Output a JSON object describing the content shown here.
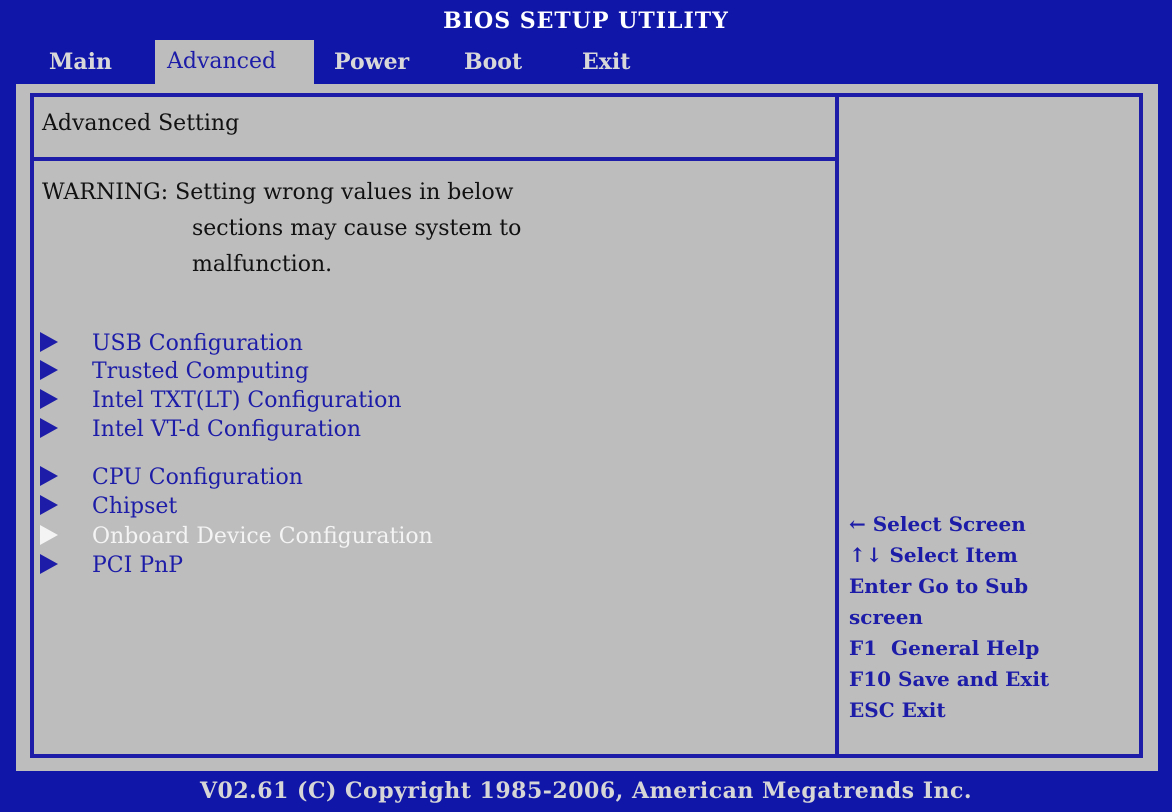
{
  "window": {
    "title": "BIOS SETUP UTILITY"
  },
  "menu": {
    "tabs": [
      "Main",
      "Advanced",
      "Power",
      "Boot",
      "Exit"
    ],
    "active_tab": "Advanced"
  },
  "main": {
    "section_title": "Advanced Setting",
    "warning": {
      "label": "WARNING:",
      "lines": [
        "Setting wrong values in below",
        "sections may cause system to",
        "malfunction."
      ]
    },
    "items": [
      {
        "label": "USB Configuration",
        "selected": false
      },
      {
        "label": "Trusted Computing",
        "selected": false
      },
      {
        "label": "Intel TXT(LT) Configuration",
        "selected": false
      },
      {
        "label": "Intel VT-d Configuration",
        "selected": false
      },
      {
        "label": "CPU Configuration",
        "selected": false
      },
      {
        "label": "Chipset",
        "selected": false
      },
      {
        "label": "Onboard Device Configuration",
        "selected": true
      },
      {
        "label": "PCI PnP",
        "selected": false
      }
    ]
  },
  "help": {
    "lines": [
      "← Select Screen",
      "↑↓ Select Item",
      "Enter Go to Sub",
      "screen",
      "F1  General Help",
      "F10 Save and Exit",
      "ESC Exit"
    ]
  },
  "footer": {
    "text": "V02.61 (C) Copyright 1985-2006, American Megatrends Inc."
  },
  "colors": {
    "background": "#1016a8",
    "panel": "#bdbdbd",
    "accent": "#1c1ca8",
    "highlight": "#f4f4f4"
  }
}
